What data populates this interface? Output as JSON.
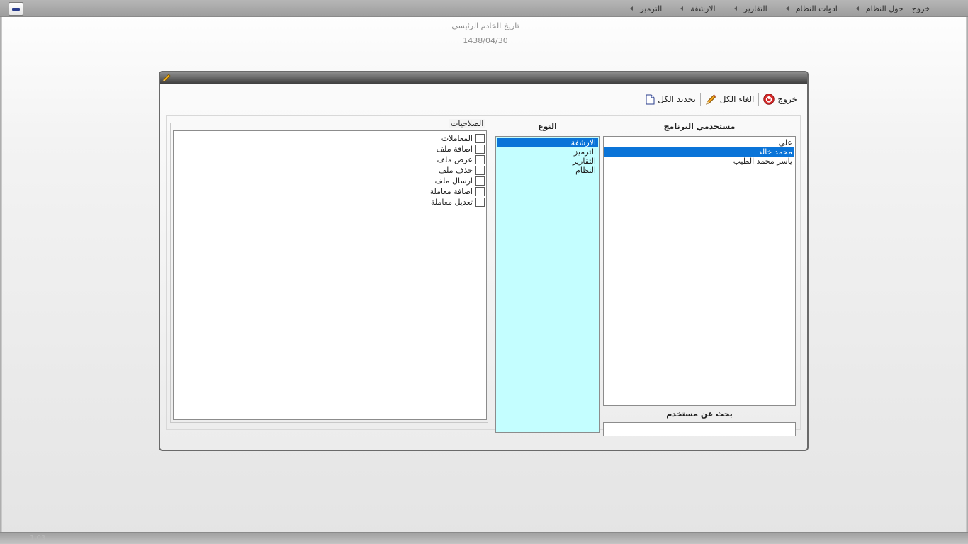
{
  "menu": {
    "items": [
      {
        "label": "الترميز"
      },
      {
        "label": "الارشفة"
      },
      {
        "label": "التقارير"
      },
      {
        "label": "ادوات النظام"
      },
      {
        "label": "حول النظام"
      },
      {
        "label": "خروج"
      }
    ]
  },
  "header": {
    "server_date_label": "تاريخ الخادم الرئيسي",
    "server_date_value": "1438/04/30"
  },
  "toolbar": {
    "select_all_label": "تحديد الكل",
    "cancel_all_label": "الغاء الكل",
    "exit_label": "خروج"
  },
  "users": {
    "heading": "مستخدمي البرنامج",
    "items": [
      {
        "label": "علي",
        "selected": false
      },
      {
        "label": "محمد خالد",
        "selected": true
      },
      {
        "label": "ياسر محمد الطيب",
        "selected": false
      }
    ],
    "search_label": "بحث عن مستخدم",
    "search_value": ""
  },
  "types": {
    "heading": "النوع",
    "items": [
      {
        "label": "الارشفة",
        "selected": true
      },
      {
        "label": "الترميز",
        "selected": false
      },
      {
        "label": "التقارير",
        "selected": false
      },
      {
        "label": "النظام",
        "selected": false
      }
    ]
  },
  "permissions": {
    "legend": "الصلاحيات",
    "items": [
      {
        "label": "المعاملات",
        "checked": false
      },
      {
        "label": "اضافة ملف",
        "checked": false
      },
      {
        "label": "عرض ملف",
        "checked": false
      },
      {
        "label": "حذف ملف",
        "checked": false
      },
      {
        "label": "ارسال ملف",
        "checked": false
      },
      {
        "label": "اضافة معاملة",
        "checked": false
      },
      {
        "label": "تعديل معاملة",
        "checked": false
      }
    ]
  },
  "footer": {
    "version": "1.03"
  },
  "colors": {
    "selection": "#0a74d8",
    "types_background": "#c4feff"
  }
}
